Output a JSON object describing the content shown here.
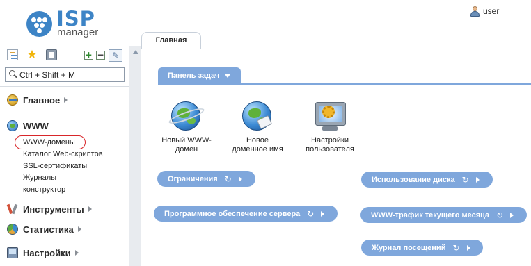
{
  "header": {
    "logo_isp": "ISP",
    "logo_manager": "manager",
    "user": "user"
  },
  "sidebar": {
    "search_placeholder": "Ctrl + Shift + M",
    "toolbar": {
      "expand": "+",
      "collapse": "−"
    },
    "groups": [
      {
        "label": "Главное",
        "icon": "home-icon"
      },
      {
        "label": "WWW",
        "icon": "globe-icon"
      },
      {
        "label": "Инструменты",
        "icon": "tools-icon"
      },
      {
        "label": "Статистика",
        "icon": "pie-chart-icon"
      },
      {
        "label": "Настройки",
        "icon": "settings-icon"
      }
    ],
    "www_items": [
      "WWW-домены",
      "Каталог Web-скриптов",
      "SSL-сертификаты",
      "Журналы",
      "конструктор"
    ]
  },
  "main": {
    "tab": "Главная",
    "tasks_label": "Панель задач",
    "actions": [
      {
        "line1": "Новый WWW-",
        "line2": "домен"
      },
      {
        "line1": "Новое",
        "line2": "доменное имя"
      },
      {
        "line1": "Настройки",
        "line2": "пользователя"
      }
    ],
    "sections": {
      "limits": "Ограничения",
      "disk": "Использование диска",
      "software": "Программное обеспечение сервера",
      "traffic": "WWW-трафик текущего месяца",
      "visits": "Журнал посещений"
    }
  },
  "colors": {
    "accent": "#7fa7dc",
    "logo": "#3d84c6",
    "highlight": "#d8262a"
  }
}
